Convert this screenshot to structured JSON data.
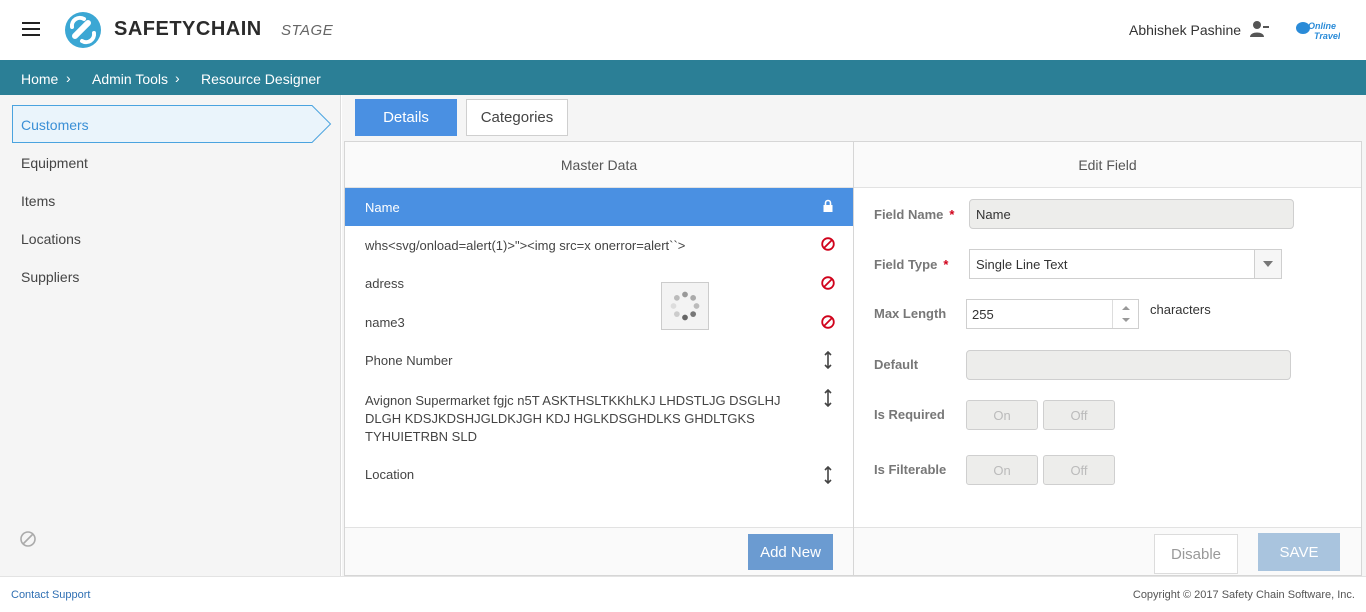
{
  "header": {
    "brand": "SAFETYCHAIN",
    "environment": "STAGE",
    "user_name": "Abhishek Pashine",
    "partner_logo_text": "Online Travel"
  },
  "breadcrumb": {
    "items": [
      "Home",
      "Admin Tools",
      "Resource Designer"
    ]
  },
  "sidebar": {
    "items": [
      "Customers",
      "Equipment",
      "Items",
      "Locations",
      "Suppliers"
    ],
    "active": "Customers"
  },
  "tabs": {
    "details": "Details",
    "categories": "Categories",
    "active": "Details"
  },
  "master_data": {
    "title": "Master Data",
    "rows": [
      {
        "label": "Name",
        "icon": "lock-icon"
      },
      {
        "label": "whs<svg/onload=alert(1)>\"><img src=x onerror=alert``>",
        "icon": "prohibited-icon"
      },
      {
        "label": "adress",
        "icon": "prohibited-icon"
      },
      {
        "label": "name3",
        "icon": "prohibited-icon"
      },
      {
        "label": "Phone Number",
        "icon": "reorder-icon"
      },
      {
        "label": "Avignon Supermarket fgjc n5T ASKTHSLTKKhLKJ LHDSTLJG DSGLHJ DLGH KDSJKDSHJGLDKJGH KDJ HGLKDSGHDLKS GHDLTGKS TYHUIETRBN SLD",
        "icon": "reorder-icon"
      },
      {
        "label": "Location",
        "icon": "reorder-icon"
      }
    ],
    "add_new": "Add New"
  },
  "edit_field": {
    "title": "Edit Field",
    "field_name_label": "Field Name",
    "field_name_value": "Name",
    "field_type_label": "Field Type",
    "field_type_value": "Single Line Text",
    "max_length_label": "Max Length",
    "max_length_value": "255",
    "max_length_unit": "characters",
    "default_label": "Default",
    "default_value": "",
    "is_required_label": "Is Required",
    "is_filterable_label": "Is Filterable",
    "on_label": "On",
    "off_label": "Off",
    "required_marker": "*",
    "disable": "Disable",
    "save": "SAVE"
  },
  "footer": {
    "contact": "Contact Support",
    "copyright": "Copyright © 2017 Safety Chain Software, Inc."
  },
  "colors": {
    "teal_bar": "#2b7f96",
    "primary_blue": "#4a90e2",
    "danger_red": "#d0021b"
  }
}
